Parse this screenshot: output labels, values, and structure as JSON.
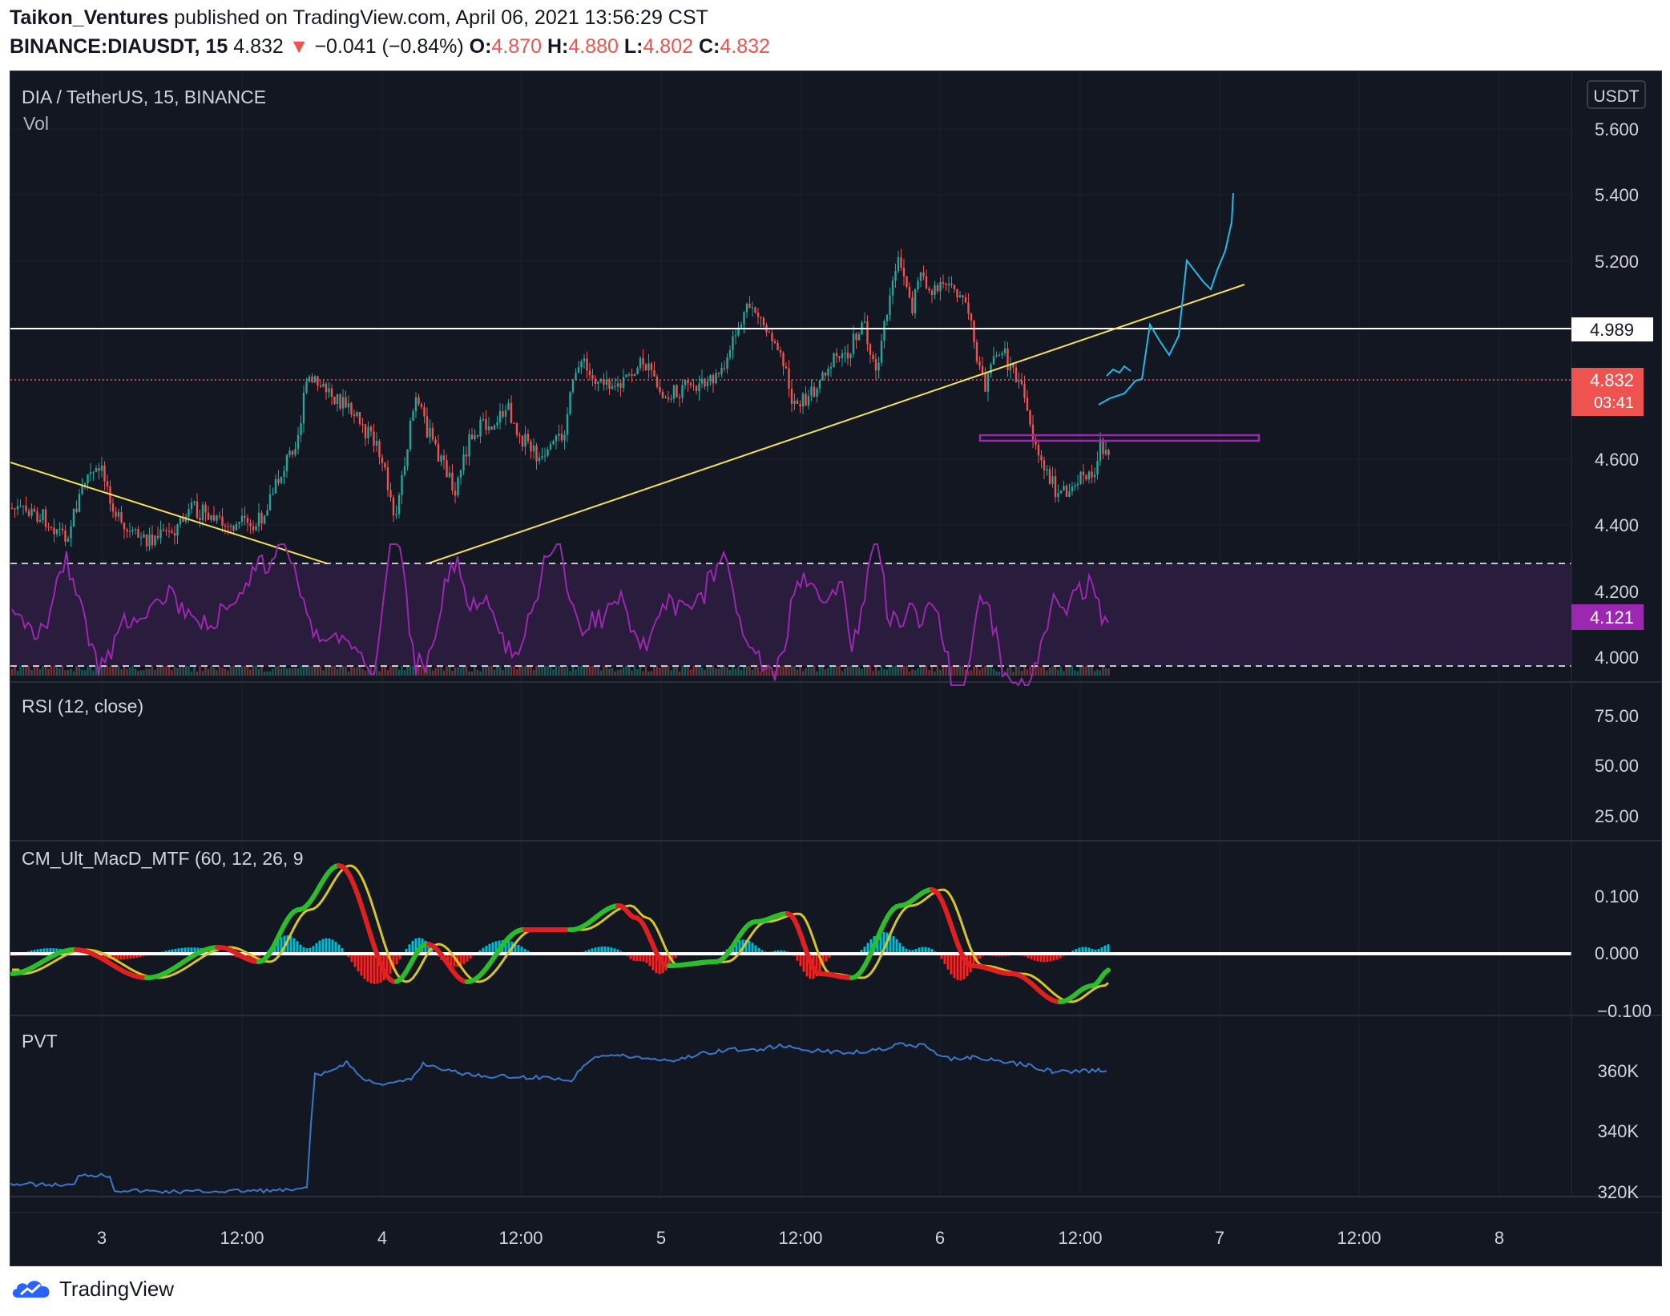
{
  "publish": {
    "author": "Taikon_Ventures",
    "text": " published on TradingView.com, April 06, 2021 13:56:29 CST"
  },
  "quote": {
    "symbol": "BINANCE:DIAUSDT, 15",
    "last": "4.832",
    "change": "−0.041 (−0.84%)",
    "open_label": "O:",
    "open": "4.870",
    "high_label": "H:",
    "high": "4.880",
    "low_label": "L:",
    "low": "4.802",
    "close_label": "C:",
    "close": "4.832"
  },
  "main_pane": {
    "title": "DIA / TetherUS, 15, BINANCE",
    "volume_label": "Vol",
    "currency": "USDT",
    "price_ticks": [
      "5.600",
      "5.400",
      "5.200",
      "4.600",
      "4.400",
      "4.200",
      "4.000"
    ],
    "resistance_label": "4.989",
    "current_price": "4.832",
    "countdown": "03:41",
    "support_label": "4.121",
    "colors": {
      "up": "#26a69a",
      "down": "#ef5350",
      "trend": "#f5e05a",
      "support": "#9c27b0",
      "forecast": "#21b9e6"
    }
  },
  "rsi_pane": {
    "title": "RSI (12, close)",
    "ticks": [
      "75.00",
      "50.00",
      "25.00"
    ]
  },
  "macd_pane": {
    "title": "CM_Ult_MacD_MTF (60, 12, 26, 9",
    "ticks": [
      "0.100",
      "0.000",
      "−0.100"
    ]
  },
  "pvt_pane": {
    "title": "PVT",
    "ticks": [
      "360K",
      "340K",
      "320K"
    ]
  },
  "time_axis": [
    "3",
    "12:00",
    "4",
    "12:00",
    "5",
    "12:00",
    "6",
    "12:00",
    "7",
    "12:00",
    "8"
  ],
  "footer": {
    "brand": "TradingView",
    "logo_icon": "tradingview-cloud-icon"
  }
}
